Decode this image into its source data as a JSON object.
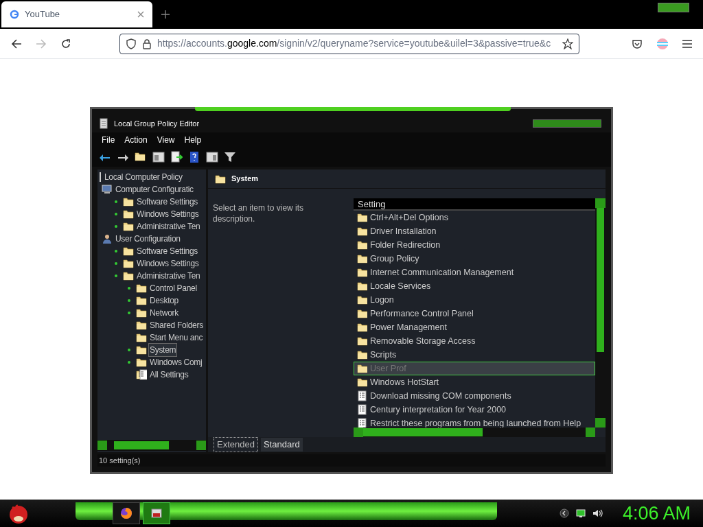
{
  "browser": {
    "tab": {
      "title": "YouTube",
      "selected": true
    },
    "address": {
      "prefix": "https://accounts.",
      "domain": "google.com",
      "rest": "/signin/v2/queryname?service=youtube&uilel=3&passive=true&c"
    }
  },
  "window": {
    "title": "Local Group Policy Editor"
  },
  "menu": [
    "File",
    "Action",
    "View",
    "Help"
  ],
  "tree": [
    {
      "label": "Local Computer Policy",
      "kind": "root",
      "expandable": false,
      "selected": false,
      "children": [
        {
          "label": "Computer Configuratic",
          "kind": "computer",
          "expandable": false,
          "selected": false,
          "children": [
            {
              "label": "Software Settings",
              "kind": "folder",
              "expandable": true,
              "selected": false
            },
            {
              "label": "Windows Settings",
              "kind": "folder",
              "expandable": true,
              "selected": false
            },
            {
              "label": "Administrative Ten",
              "kind": "folder",
              "expandable": true,
              "selected": false
            }
          ]
        },
        {
          "label": "User Configuration",
          "kind": "user",
          "expandable": false,
          "selected": false,
          "children": [
            {
              "label": "Software Settings",
              "kind": "folder",
              "expandable": true,
              "selected": false
            },
            {
              "label": "Windows Settings",
              "kind": "folder",
              "expandable": true,
              "selected": false
            },
            {
              "label": "Administrative Ten",
              "kind": "folder",
              "expandable": true,
              "selected": false,
              "children": [
                {
                  "label": "Control Panel",
                  "kind": "folder",
                  "expandable": true,
                  "selected": false
                },
                {
                  "label": "Desktop",
                  "kind": "folder",
                  "expandable": true,
                  "selected": false
                },
                {
                  "label": "Network",
                  "kind": "folder",
                  "expandable": true,
                  "selected": false
                },
                {
                  "label": "Shared Folders",
                  "kind": "folder",
                  "expandable": false,
                  "selected": false
                },
                {
                  "label": "Start Menu anc",
                  "kind": "folder",
                  "expandable": false,
                  "selected": false
                },
                {
                  "label": "System",
                  "kind": "folder",
                  "expandable": true,
                  "selected": true
                },
                {
                  "label": "Windows Comj",
                  "kind": "folder",
                  "expandable": true,
                  "selected": false
                },
                {
                  "label": "All Settings",
                  "kind": "settings",
                  "expandable": false,
                  "selected": false
                }
              ]
            }
          ]
        }
      ]
    }
  ],
  "details": {
    "heading": "System",
    "description": "Select an item to view its description.",
    "column": "Setting",
    "rows": [
      {
        "label": "Ctrl+Alt+Del Options",
        "kind": "folder",
        "selected": false
      },
      {
        "label": "Driver Installation",
        "kind": "folder",
        "selected": false
      },
      {
        "label": "Folder Redirection",
        "kind": "folder",
        "selected": false
      },
      {
        "label": "Group Policy",
        "kind": "folder",
        "selected": false
      },
      {
        "label": "Internet Communication Management",
        "kind": "folder",
        "selected": false
      },
      {
        "label": "Locale Services",
        "kind": "folder",
        "selected": false
      },
      {
        "label": "Logon",
        "kind": "folder",
        "selected": false
      },
      {
        "label": "Performance Control Panel",
        "kind": "folder",
        "selected": false
      },
      {
        "label": "Power Management",
        "kind": "folder",
        "selected": false
      },
      {
        "label": "Removable Storage Access",
        "kind": "folder",
        "selected": false
      },
      {
        "label": "Scripts",
        "kind": "folder",
        "selected": false
      },
      {
        "label": "User Prof",
        "kind": "folder",
        "selected": true
      },
      {
        "label": "Windows HotStart",
        "kind": "folder",
        "selected": false
      },
      {
        "label": "Download missing COM components",
        "kind": "policy",
        "selected": false
      },
      {
        "label": "Century interpretation for Year 2000",
        "kind": "policy",
        "selected": false
      },
      {
        "label": "Restrict these programs from being launched from Help",
        "kind": "policy",
        "selected": false
      }
    ]
  },
  "view_tabs": [
    {
      "label": "Extended",
      "selected": true
    },
    {
      "label": "Standard",
      "selected": false
    }
  ],
  "status_bar": "10 setting(s)",
  "taskbar": {
    "apps": [
      {
        "kind": "browser",
        "active": false
      },
      {
        "kind": "policy",
        "active": true
      }
    ],
    "clock": "4:06 AM"
  }
}
